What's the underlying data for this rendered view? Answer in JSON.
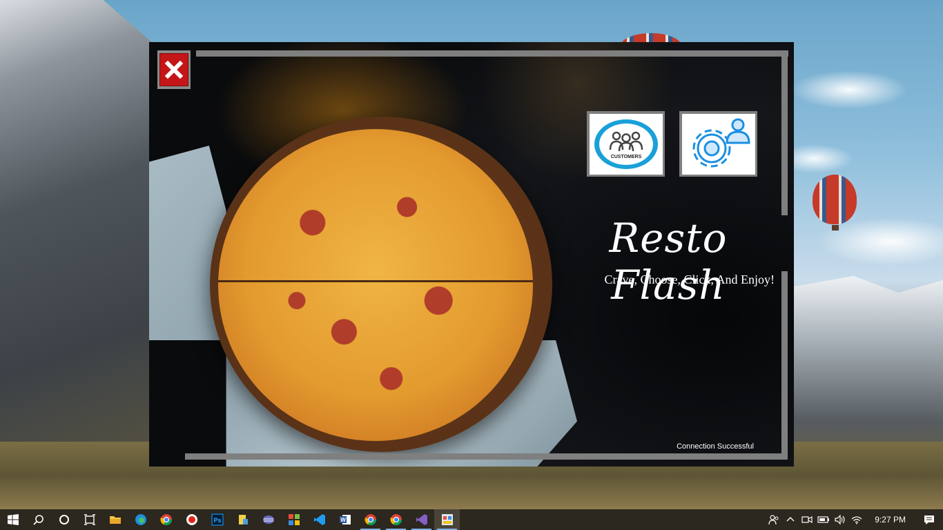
{
  "app": {
    "title": "Resto Flash",
    "tagline": "Crave, Choose, Click, And Enjoy!",
    "status": "Connection Successful",
    "close_button": {
      "icon": "close-icon",
      "color": "#c41618"
    },
    "buttons": [
      {
        "name": "customers-button",
        "icon": "customers-icon",
        "label": "CUSTOMERS"
      },
      {
        "name": "admin-settings-button",
        "icon": "admin-gear-icon"
      }
    ]
  },
  "taskbar": {
    "apps": [
      {
        "name": "start-button",
        "icon": "windows-icon"
      },
      {
        "name": "search-button",
        "icon": "search-icon"
      },
      {
        "name": "cortana-button",
        "icon": "cortana-icon"
      },
      {
        "name": "task-view-button",
        "icon": "task-view-icon"
      },
      {
        "name": "file-explorer-button",
        "icon": "folder-icon"
      },
      {
        "name": "edge-button",
        "icon": "edge-icon"
      },
      {
        "name": "chrome-button",
        "icon": "chrome-icon"
      },
      {
        "name": "record-button",
        "icon": "record-icon"
      },
      {
        "name": "photoshop-button",
        "icon": "photoshop-icon",
        "label": "Ps"
      },
      {
        "name": "app-button-1",
        "icon": "app-icon"
      },
      {
        "name": "app-button-2",
        "icon": "app-stack-icon"
      },
      {
        "name": "app-button-3",
        "icon": "tiles-icon"
      },
      {
        "name": "vscode-button",
        "icon": "vscode-icon"
      },
      {
        "name": "word-button",
        "icon": "word-icon"
      },
      {
        "name": "chrome-button-2",
        "icon": "chrome-icon"
      },
      {
        "name": "chrome-button-3",
        "icon": "chrome-icon"
      },
      {
        "name": "visual-studio-button",
        "icon": "visual-studio-icon"
      },
      {
        "name": "resto-flash-taskbar-button",
        "icon": "app-window-icon"
      }
    ],
    "clock": "9:27 PM"
  }
}
